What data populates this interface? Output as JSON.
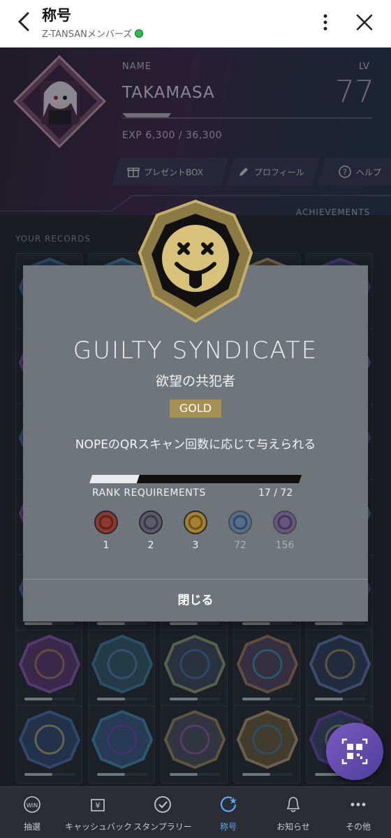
{
  "header": {
    "title": "称号",
    "subtitle": "Z-TANSANメンバーズ"
  },
  "profile": {
    "name_label": "NAME",
    "lv_label": "LV",
    "username": "TAKAMASA",
    "level": "77",
    "exp_text": "EXP 6,300 / 36,300",
    "exp_progress": 0.17,
    "actions": [
      {
        "label": "プレゼントBOX",
        "icon": "gift-box-icon"
      },
      {
        "label": "プロフィール",
        "icon": "pencil-icon"
      },
      {
        "label": "ヘルプ",
        "icon": "help-circle-icon"
      }
    ],
    "achievements_label": "ACHIEVEMENTS"
  },
  "records": {
    "label": "YOUR RECORDS"
  },
  "modal": {
    "title": "GUILTY SYNDICATE",
    "subtitle": "欲望の共犯者",
    "rank_badge": "GOLD",
    "description": "NOPEのQRスキャン回数に応じて与えられる",
    "progress": 0.236,
    "requirements_label": "RANK REQUIREMENTS",
    "count": "17 / 72",
    "ranks": [
      {
        "label": "1",
        "color": "#8c3a30",
        "reached": true
      },
      {
        "label": "2",
        "color": "#5a5a6a",
        "reached": true
      },
      {
        "label": "3",
        "color": "#a5822e",
        "reached": true
      },
      {
        "label": "72",
        "color": "#3e6a9a",
        "reached": false
      },
      {
        "label": "156",
        "color": "#5e3f7e",
        "reached": false
      }
    ],
    "close_label": "閉じる"
  },
  "nav": {
    "items": [
      {
        "label": "抽選",
        "icon": "win-icon",
        "active": false
      },
      {
        "label": "キャッシュバック",
        "icon": "cashback-icon",
        "active": false
      },
      {
        "label": "スタンプラリー",
        "icon": "stamp-check-icon",
        "active": false
      },
      {
        "label": "称号",
        "icon": "title-badge-icon",
        "active": true
      },
      {
        "label": "お知らせ",
        "icon": "bell-icon",
        "active": false
      },
      {
        "label": "その他",
        "icon": "more-dots-icon",
        "active": false
      }
    ]
  },
  "colors": {
    "accent": "#5fa8ff",
    "gold": "#a58f52"
  }
}
